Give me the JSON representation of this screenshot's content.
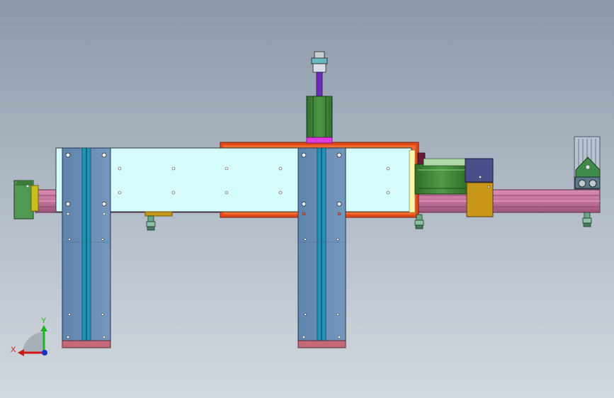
{
  "viewport": {
    "background_top": "#8c99a8",
    "background_bottom": "#d2d8df"
  },
  "model": {
    "colors": {
      "rail": "#c4739c",
      "rail_dark": "#8a4a6a",
      "light_panel": "#d6fbfb",
      "orange_frame": "#e04a1a",
      "column": "#6b8fb5",
      "column_dark": "#3d5f85",
      "column_groove": "#1f93b8",
      "foot": "#c46a78",
      "motor_green": "#3f8a3a",
      "motor_dark": "#2a5a25",
      "shaft_purple": "#6a2fb8",
      "magenta": "#e03ae0",
      "gold": "#c8961a",
      "navy_block": "#4a4f8a",
      "end_green": "#4f9a50",
      "end_yellow": "#c8c020",
      "suction_cup": "#6aa888"
    }
  },
  "triad": {
    "x_label": "X",
    "y_label": "Y",
    "x_color": "#d01818",
    "y_color": "#18b818",
    "z_color": "#1830d0"
  }
}
